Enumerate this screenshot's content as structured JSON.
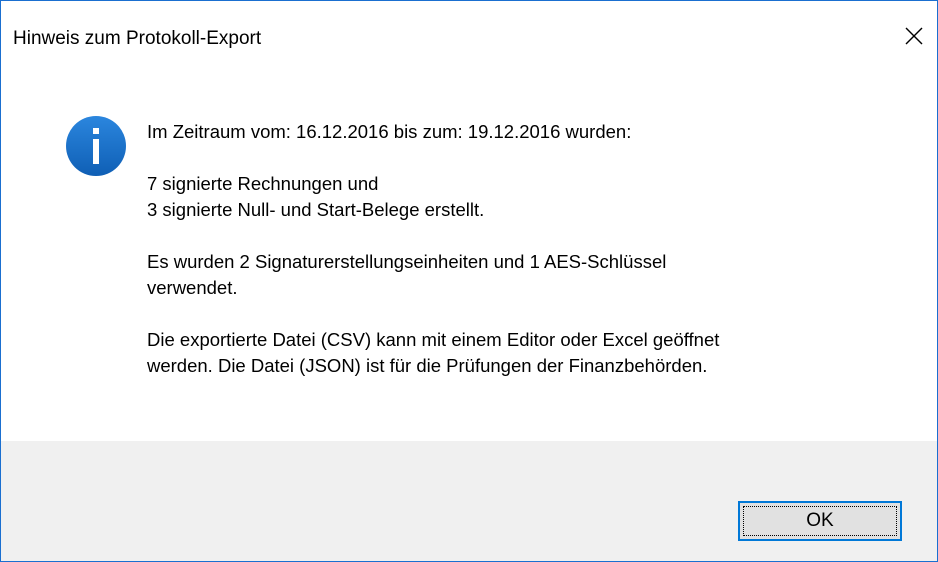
{
  "window": {
    "title": "Hinweis zum Protokoll-Export",
    "close_icon": "close-icon",
    "accent_color": "#0078d7"
  },
  "message": {
    "icon": "info-icon",
    "icon_color": "#1a73c8",
    "line1": "Im Zeitraum vom: 16.12.2016 bis zum: 19.12.2016 wurden:",
    "line2": "7 signierte Rechnungen und",
    "line3": "3 signierte Null- und Start-Belege erstellt.",
    "line4": "Es wurden 2 Signaturerstellungseinheiten und 1 AES-Schlüssel",
    "line5": "verwendet.",
    "line6": "Die exportierte Datei (CSV) kann mit einem Editor oder Excel geöffnet",
    "line7": "werden. Die Datei (JSON) ist für die Prüfungen der Finanzbehörden."
  },
  "buttons": {
    "ok_label": "OK"
  }
}
